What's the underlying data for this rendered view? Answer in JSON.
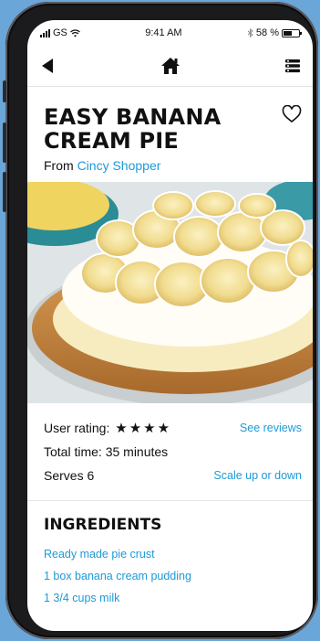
{
  "status": {
    "carrier": "GS",
    "time": "9:41 AM",
    "battery": "58 %",
    "battery_level": 0.58
  },
  "nav": {
    "back_icon": "back-arrow-icon",
    "home_icon": "home-icon",
    "menu_icon": "menu-icon"
  },
  "recipe": {
    "title": "EASY BANANA CREAM PIE",
    "from_prefix": "From",
    "source": "Cincy Shopper",
    "rating_label": "User rating:",
    "rating_stars": 4,
    "reviews_link": "See reviews",
    "total_time": "Total time: 35 minutes",
    "serves": "Serves 6",
    "scale_link": "Scale up or down"
  },
  "ingredients": {
    "heading": "INGREDIENTS",
    "items": [
      "Ready made pie crust",
      "1 box banana cream pudding",
      "1 3/4 cups milk"
    ]
  }
}
